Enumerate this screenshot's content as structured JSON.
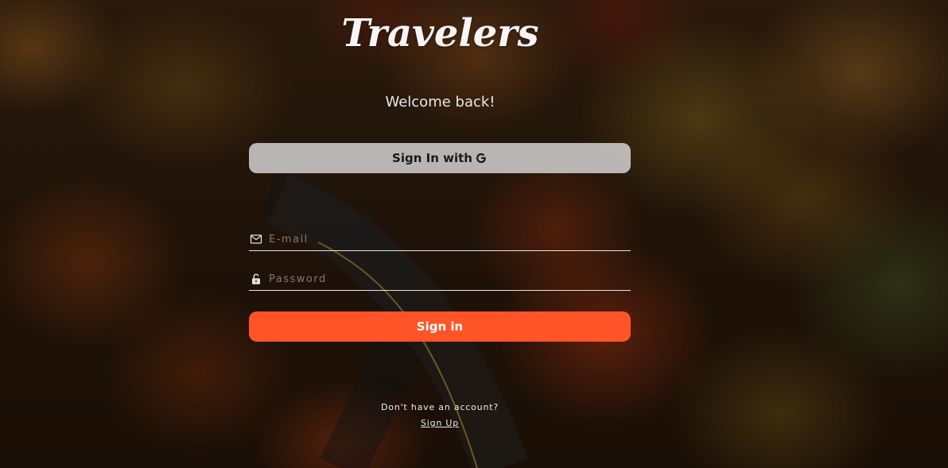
{
  "brand": {
    "title": "Travelers"
  },
  "welcome": {
    "text": "Welcome back!"
  },
  "google_signin": {
    "label": "Sign In with",
    "icon": "google-g-icon"
  },
  "form": {
    "email": {
      "placeholder": "E-mail",
      "value": "",
      "icon": "envelope-icon"
    },
    "password": {
      "placeholder": "Password",
      "value": "",
      "icon": "unlock-icon"
    },
    "submit_label": "Sign in"
  },
  "footer": {
    "prompt": "Don't have an account?",
    "signup_label": "Sign Up"
  },
  "colors": {
    "accent": "#ff5427",
    "google_button_bg": "#d2d2d2",
    "text": "#f2f2f2"
  }
}
